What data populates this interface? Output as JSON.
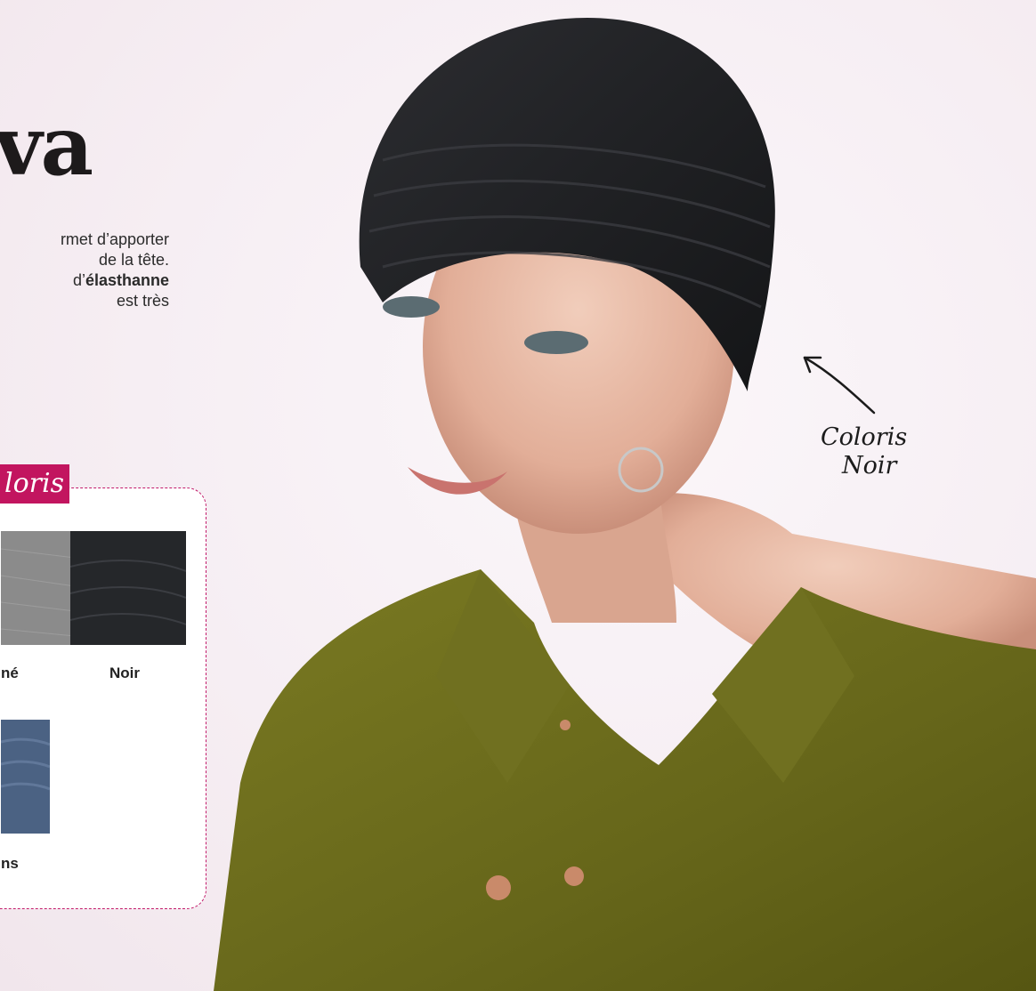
{
  "product": {
    "title": "va",
    "description_lines": [
      {
        "text": "rmet d’apporter"
      },
      {
        "text": " de la tête."
      },
      {
        "text_before": "d’",
        "bold": "élasthanne"
      },
      {
        "text": "est très"
      }
    ]
  },
  "coloris_panel": {
    "tab_label": "loris",
    "swatches": [
      {
        "label": "né",
        "color": "#8b8b8b"
      },
      {
        "label": "Noir",
        "color": "#25272a"
      },
      {
        "label": "ns",
        "color": "#4b6283"
      }
    ]
  },
  "annotation": {
    "line1": "Coloris",
    "line2": "Noir"
  },
  "colors": {
    "accent": "#c2155f",
    "background": "#f6eef3",
    "shirt": "#6a6a1c",
    "cap": "#1e1f22"
  }
}
